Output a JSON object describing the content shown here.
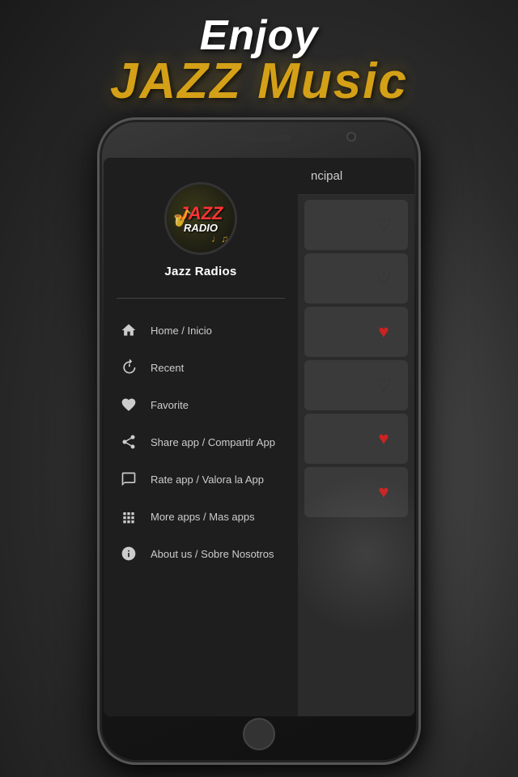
{
  "header": {
    "enjoy_label": "Enjoy",
    "jazz_label": "JAZZ Music"
  },
  "app": {
    "name": "Jazz Radios",
    "logo_jazz": "JAZZ",
    "logo_radio": "RADIO"
  },
  "nav_items": [
    {
      "id": "home",
      "label": "Home / Inicio",
      "icon": "home"
    },
    {
      "id": "recent",
      "label": "Recent",
      "icon": "recent"
    },
    {
      "id": "favorite",
      "label": "Favorite",
      "icon": "favorite"
    },
    {
      "id": "share",
      "label": "Share app / Compartir App",
      "icon": "share"
    },
    {
      "id": "rate",
      "label": "Rate app / Valora la App",
      "icon": "rate"
    },
    {
      "id": "more-apps",
      "label": "More apps / Mas apps",
      "icon": "grid"
    },
    {
      "id": "about",
      "label": "About us / Sobre Nosotros",
      "icon": "info"
    }
  ],
  "main": {
    "header_title": "ncipal"
  },
  "radio_list": [
    {
      "id": 1,
      "heart": "outline"
    },
    {
      "id": 2,
      "heart": "outline"
    },
    {
      "id": 3,
      "heart": "filled"
    },
    {
      "id": 4,
      "heart": "outline"
    },
    {
      "id": 5,
      "heart": "filled"
    },
    {
      "id": 6,
      "heart": "filled"
    }
  ]
}
